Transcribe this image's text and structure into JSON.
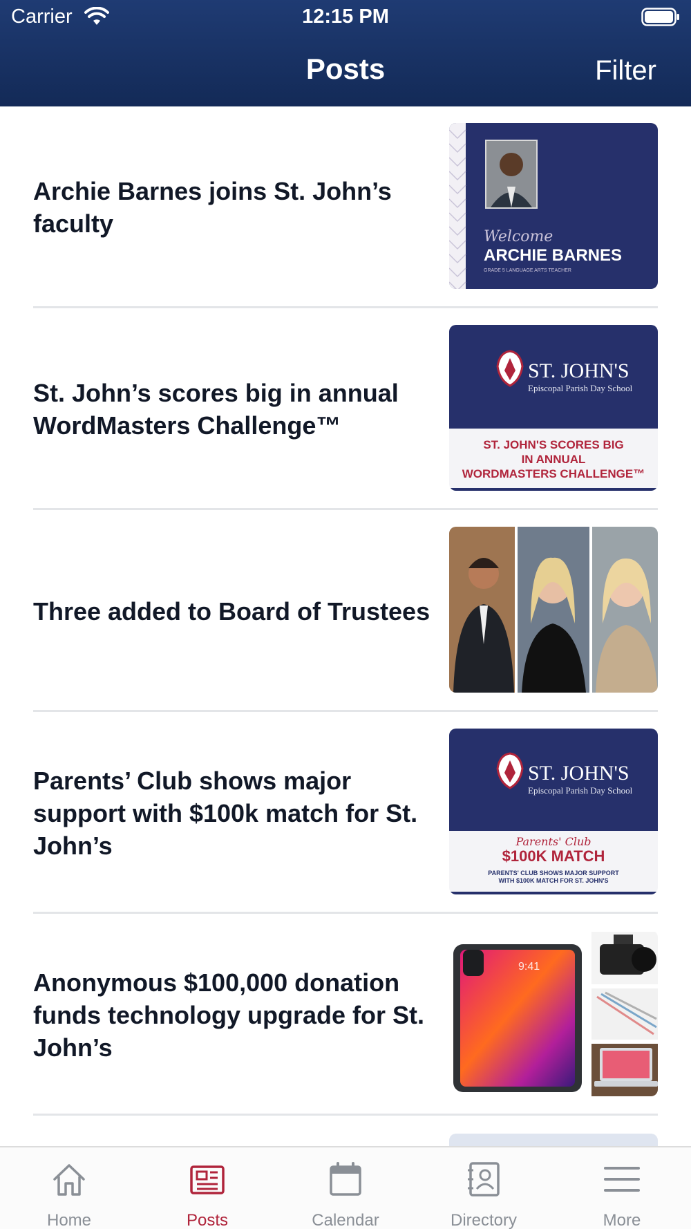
{
  "status_bar": {
    "carrier": "Carrier",
    "time": "12:15 PM"
  },
  "header": {
    "title": "Posts",
    "filter_label": "Filter"
  },
  "posts": [
    {
      "title": "Archie Barnes joins St. John’s faculty",
      "thumb": {
        "welcome": "Welcome",
        "name": "ARCHIE BARNES",
        "role": "GRADE 5 LANGUAGE ARTS TEACHER"
      }
    },
    {
      "title": "St. John’s scores big in annual WordMasters Challenge™",
      "thumb": {
        "logo_name": "ST. JOHN'S",
        "logo_sub": "Episcopal Parish Day School",
        "line1": "ST. JOHN'S SCORES BIG",
        "line2": "IN ANNUAL",
        "line3": "WORDMASTERS CHALLENGE™"
      }
    },
    {
      "title": "Three added to Board of Trustees",
      "thumb": {}
    },
    {
      "title": "Parents’ Club shows major support with $100k match for St. John’s",
      "thumb": {
        "logo_name": "ST. JOHN'S",
        "logo_sub": "Episcopal Parish Day School",
        "script": "Parents' Club",
        "headline": "$100K MATCH",
        "sub1": "PARENTS' CLUB SHOWS MAJOR SUPPORT",
        "sub2": "WITH $100K MATCH FOR ST. JOHN'S"
      }
    },
    {
      "title": "Anonymous $100,000 donation funds technology upgrade for St. John’s",
      "thumb": {
        "device_time": "9:41"
      }
    }
  ],
  "tabs": [
    {
      "label": "Home",
      "icon": "home-icon"
    },
    {
      "label": "Posts",
      "icon": "posts-icon",
      "active": true
    },
    {
      "label": "Calendar",
      "icon": "calendar-icon"
    },
    {
      "label": "Directory",
      "icon": "directory-icon"
    },
    {
      "label": "More",
      "icon": "menu-icon"
    }
  ],
  "colors": {
    "header_top": "#1f3b73",
    "header_bottom": "#132a57",
    "navy": "#26306b",
    "accent": "#b0243b",
    "tab_inactive": "#8a8f96"
  }
}
